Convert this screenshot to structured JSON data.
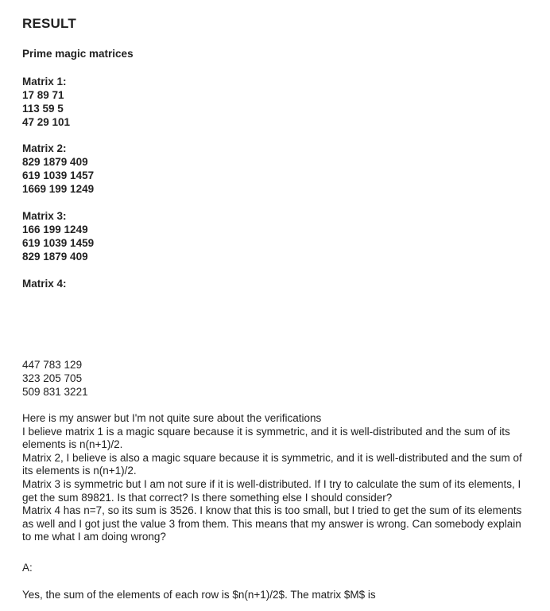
{
  "heading": "RESULT",
  "subtitle": "Prime magic matrices",
  "matrices": [
    {
      "label": "Matrix 1:",
      "rows": [
        "17 89 71",
        "113 59 5",
        "47 29 101"
      ]
    },
    {
      "label": "Matrix 2:",
      "rows": [
        "829 1879 409",
        "619 1039 1457",
        "1669 199 1249"
      ]
    },
    {
      "label": "Matrix 3:",
      "rows": [
        "166 199 1249",
        "619 1039 1459",
        "829 1879 409"
      ]
    },
    {
      "label": "Matrix 4:",
      "rows": [
        "447 783 129",
        "323 205 705",
        "509 831 3221"
      ]
    }
  ],
  "question": [
    "Here is my answer but I'm not quite sure about the verifications",
    "I believe matrix 1 is a magic square because it is symmetric, and it is well-distributed and the sum of its elements is n(n+1)/2.",
    "Matrix 2, I believe is also a magic square because it is symmetric, and it is well-distributed and the sum of its elements is n(n+1)/2.",
    "Matrix 3 is symmetric but I am not sure if it is well-distributed. If I try to calculate the sum of its elements, I get the sum 89821. Is that correct? Is there something else I should consider?",
    "Matrix 4 has n=7, so its sum is 3526. I know that this is too small, but I tried to get the sum of its elements as well and I got just the value 3 from them. This means that my answer is wrong. Can somebody explain to me what I am doing wrong?"
  ],
  "answer_label": "A:",
  "answer_text": "Yes,  the sum of the elements of each row is $n(n+1)/2$.  The matrix $M$ is"
}
